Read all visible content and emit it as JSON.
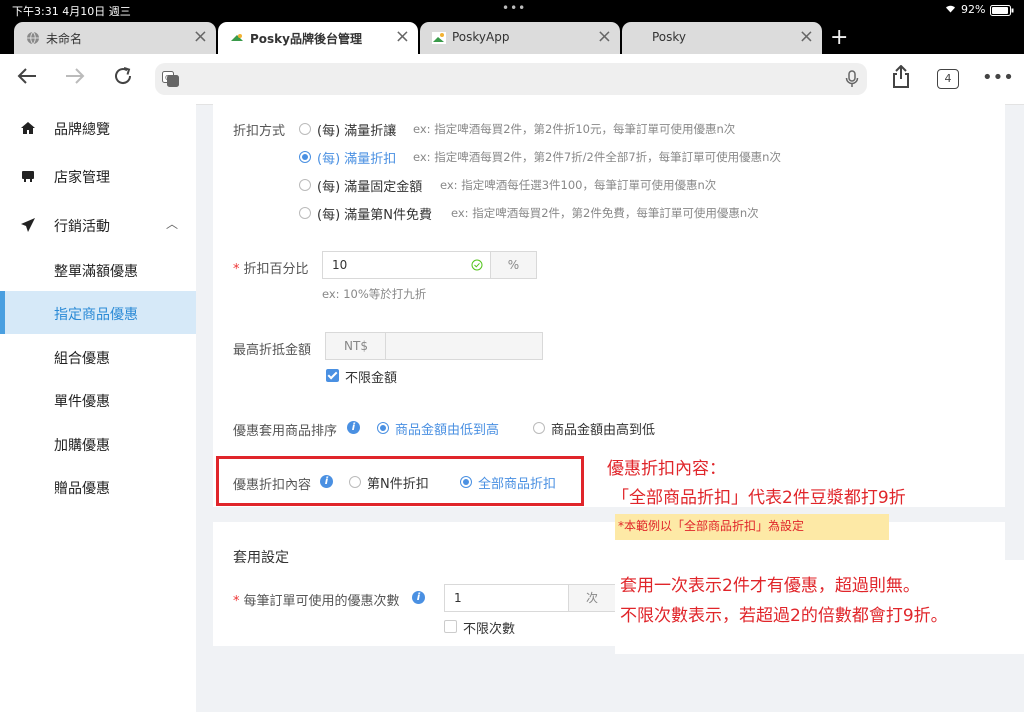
{
  "status": {
    "time_date": "下午3:31  4月10日 週三",
    "battery": "92%"
  },
  "tabs": [
    {
      "label": "未命名"
    },
    {
      "label": "Posky品牌後台管理"
    },
    {
      "label": "PoskyApp"
    },
    {
      "label": "Posky"
    }
  ],
  "toolbar": {
    "tab_count": "4"
  },
  "sidebar": {
    "items": [
      {
        "label": "品牌總覽",
        "icon": "home-icon"
      },
      {
        "label": "店家管理",
        "icon": "store-icon"
      },
      {
        "label": "行銷活動",
        "icon": "send-icon"
      }
    ],
    "sub_items": [
      {
        "label": "整單滿額優惠"
      },
      {
        "label": "指定商品優惠"
      },
      {
        "label": "組合優惠"
      },
      {
        "label": "單件優惠"
      },
      {
        "label": "加購優惠"
      },
      {
        "label": "贈品優惠"
      }
    ]
  },
  "form": {
    "discount_method_label": "折扣方式",
    "methods": [
      {
        "label": "(每) 滿量折讓",
        "hint": "ex: 指定啤酒每買2件，第2件折10元，每筆訂單可使用優惠n次"
      },
      {
        "label": "(每) 滿量折扣",
        "hint": "ex: 指定啤酒每買2件，第2件7折/2件全部7折，每筆訂單可使用優惠n次"
      },
      {
        "label": "(每) 滿量固定金額",
        "hint": "ex: 指定啤酒每任選3件100，每筆訂單可使用優惠n次"
      },
      {
        "label": "(每) 滿量第N件免費",
        "hint": "ex: 指定啤酒每買2件，第2件免費，每筆訂單可使用優惠n次"
      }
    ],
    "percent_label": "折扣百分比",
    "percent_value": "10",
    "percent_unit": "%",
    "percent_hint": "ex: 10%等於打九折",
    "max_label": "最高折抵金額",
    "max_prefix": "NT$",
    "max_unlimited": "不限金額",
    "sort_label": "優惠套用商品排序",
    "sort_options": [
      "商品金額由低到高",
      "商品金額由高到低"
    ],
    "content_label": "優惠折扣內容",
    "content_options": [
      "第N件折扣",
      "全部商品折扣"
    ],
    "apply_title": "套用設定",
    "times_label": "每筆訂單可使用的優惠次數",
    "times_value": "1",
    "times_unit": "次",
    "times_unlimited": "不限次數"
  },
  "annotations": {
    "line1": "優惠折扣內容：",
    "line2": "「全部商品折扣」代表2件豆漿都打9折",
    "note": "*本範例以「全部商品折扣」為設定",
    "line3": "套用一次表示2件才有優惠，超過則無。",
    "line4": "不限次數表示，若超過2的倍數都會打9折。"
  }
}
